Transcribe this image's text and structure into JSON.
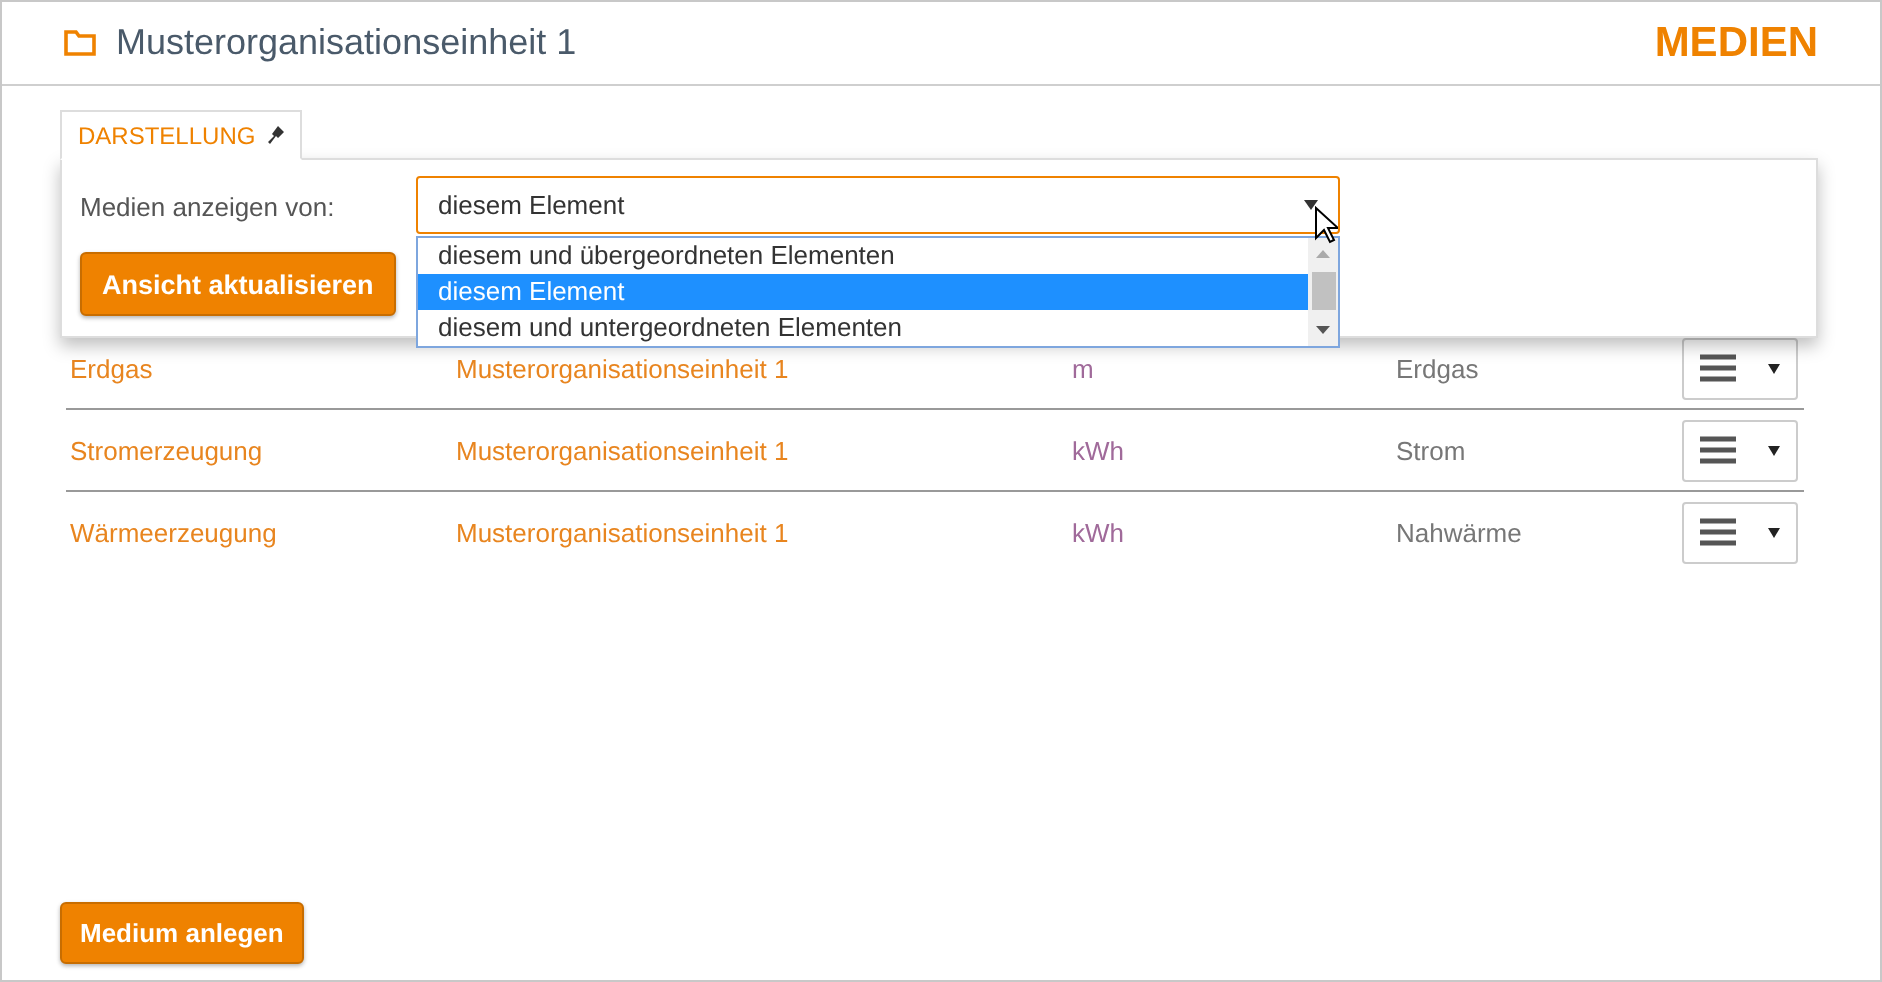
{
  "header": {
    "title": "Musterorganisationseinheit 1",
    "section": "MEDIEN"
  },
  "tabs": [
    {
      "label": "DARSTELLUNG",
      "selected": true
    }
  ],
  "filter": {
    "label": "Medien anzeigen von:",
    "value": "diesem Element",
    "expanded": true,
    "options": [
      {
        "label": "diesem und übergeordneten Elementen",
        "selected": false
      },
      {
        "label": "diesem Element",
        "selected": true
      },
      {
        "label": "diesem und untergeordneten Elementen",
        "selected": false
      }
    ],
    "button": "Ansicht aktualisieren"
  },
  "table": {
    "rows": [
      {
        "name": "Erdgas",
        "unit": "Musterorganisationseinheit 1",
        "measure": "m",
        "medium": "Erdgas"
      },
      {
        "name": "Stromerzeugung",
        "unit": "Musterorganisationseinheit 1",
        "measure": "kWh",
        "medium": "Strom"
      },
      {
        "name": "Wärmeerzeugung",
        "unit": "Musterorganisationseinheit 1",
        "measure": "kWh",
        "medium": "Nahwärme"
      }
    ]
  },
  "create_button": "Medium anlegen"
}
